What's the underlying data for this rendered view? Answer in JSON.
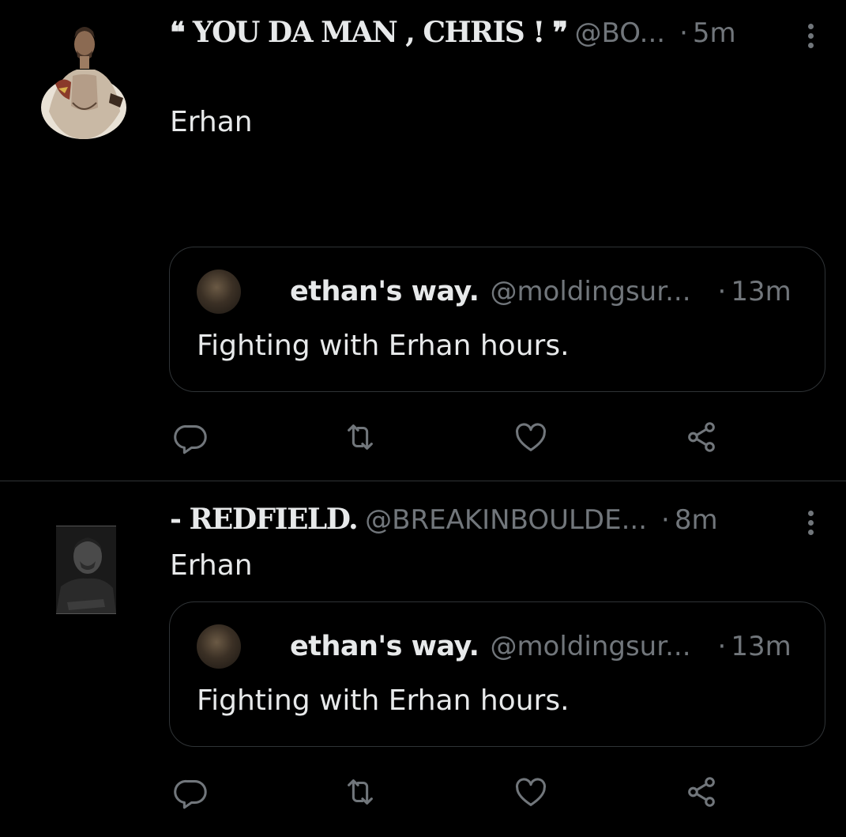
{
  "colors": {
    "background": "#000000",
    "text_primary": "#e7e9ea",
    "text_secondary": "#71767b",
    "border": "#2f3336"
  },
  "tweets": [
    {
      "display_name": "❝ YOU DA MAN , CHRIS ! ❞",
      "handle": "@BO...",
      "dot": "·",
      "time": "5m",
      "text": "Erhan",
      "avatar_icon": "shirtless-man-avatar",
      "quote": {
        "display_name": "ethan's way.",
        "handle": "@moldingsur...",
        "dot": "·",
        "time": "13m",
        "text": "Fighting with Erhan hours."
      }
    },
    {
      "display_name": "- REDFIELD.",
      "handle": "@BREAKINBOULDE...",
      "dot": "·",
      "time": "8m",
      "text": "Erhan",
      "avatar_icon": "man-portrait-avatar",
      "quote": {
        "display_name": "ethan's way.",
        "handle": "@moldingsur...",
        "dot": "·",
        "time": "13m",
        "text": "Fighting with Erhan hours."
      }
    }
  ],
  "icons": {
    "reply": "reply-icon",
    "retweet": "retweet-icon",
    "like": "heart-icon",
    "share": "share-icon",
    "more": "more-vertical-icon"
  }
}
